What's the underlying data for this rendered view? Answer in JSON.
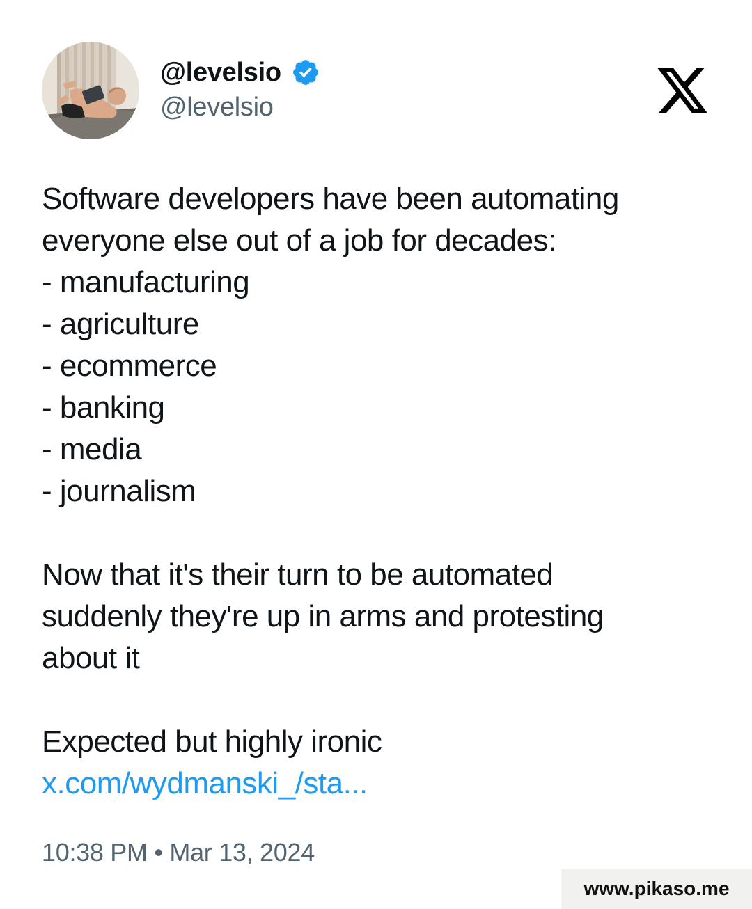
{
  "author": {
    "display_name": "@levelsio",
    "handle": "@levelsio",
    "verified": true,
    "avatar_icon": "avatar-photo"
  },
  "brand": {
    "logo_icon": "x-logo-icon"
  },
  "tweet": {
    "lines": [
      "Software developers have been automating",
      "everyone else out of a job for decades:",
      "- manufacturing",
      "- agriculture",
      "- ecommerce",
      "- banking",
      "- media",
      "- journalism",
      "",
      "Now that it's their turn to be automated",
      "suddenly they're up in arms and protesting",
      "about it",
      "",
      "Expected but highly ironic"
    ],
    "link": "x.com/wydmanski_/sta..."
  },
  "meta": {
    "timestamp": "10:38 PM • Mar 13, 2024"
  },
  "watermark": {
    "text": "www.pikaso.me"
  },
  "colors": {
    "text": "#0f1419",
    "secondary": "#536471",
    "link": "#1d9bf0",
    "verified": "#1d9bf0"
  }
}
